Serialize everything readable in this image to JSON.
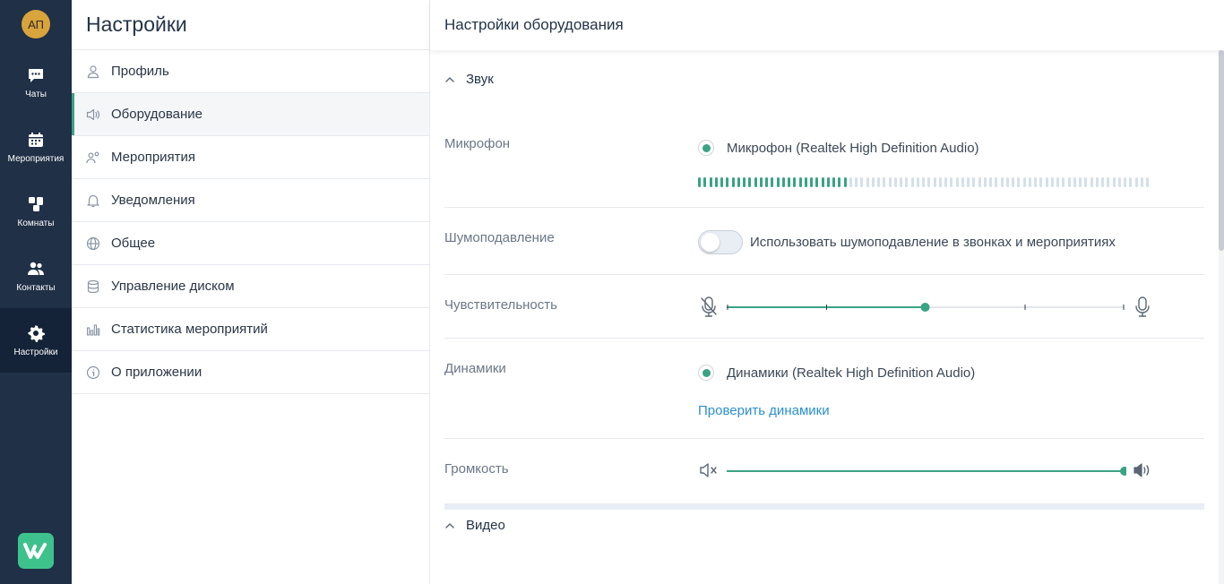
{
  "rail": {
    "avatar_initials": "АП",
    "items": [
      {
        "label": "Чаты",
        "icon": "chat-icon"
      },
      {
        "label": "Мероприятия",
        "icon": "calendar-icon"
      },
      {
        "label": "Комнаты",
        "icon": "rooms-icon"
      },
      {
        "label": "Контакты",
        "icon": "contacts-icon"
      },
      {
        "label": "Настройки",
        "icon": "gear-icon",
        "active": true
      }
    ],
    "logo_icon": "app-logo-icon"
  },
  "nav": {
    "title": "Настройки",
    "items": [
      {
        "label": "Профиль",
        "icon": "user-icon"
      },
      {
        "label": "Оборудование",
        "icon": "speaker-icon",
        "active": true
      },
      {
        "label": "Мероприятия",
        "icon": "people-icon"
      },
      {
        "label": "Уведомления",
        "icon": "bell-icon"
      },
      {
        "label": "Общее",
        "icon": "globe-icon"
      },
      {
        "label": "Управление диском",
        "icon": "database-icon"
      },
      {
        "label": "Статистика мероприятий",
        "icon": "stats-icon"
      },
      {
        "label": "О приложении",
        "icon": "info-icon"
      }
    ]
  },
  "main": {
    "title": "Настройки оборудования",
    "sound": {
      "section_label": "Звук",
      "microphone": {
        "label": "Микрофон",
        "device": "Микрофон (Realtek High Definition Audio)",
        "level_fraction": 0.33
      },
      "noise": {
        "label": "Шумоподавление",
        "toggle_label": "Использовать шумоподавление в звонках и мероприятиях",
        "enabled": false
      },
      "sensitivity": {
        "label": "Чувствительность",
        "value_fraction": 0.5
      },
      "speakers": {
        "label": "Динамики",
        "device": "Динамики (Realtek High Definition Audio)",
        "test_link": "Проверить динамики"
      },
      "volume": {
        "label": "Громкость",
        "value_fraction": 1.0
      }
    },
    "video": {
      "section_label": "Видео"
    }
  },
  "colors": {
    "rail_bg": "#1f3047",
    "accent": "#3aa383",
    "link": "#2a8fce",
    "avatar": "#d9a43b",
    "logo": "#3ec28b"
  }
}
